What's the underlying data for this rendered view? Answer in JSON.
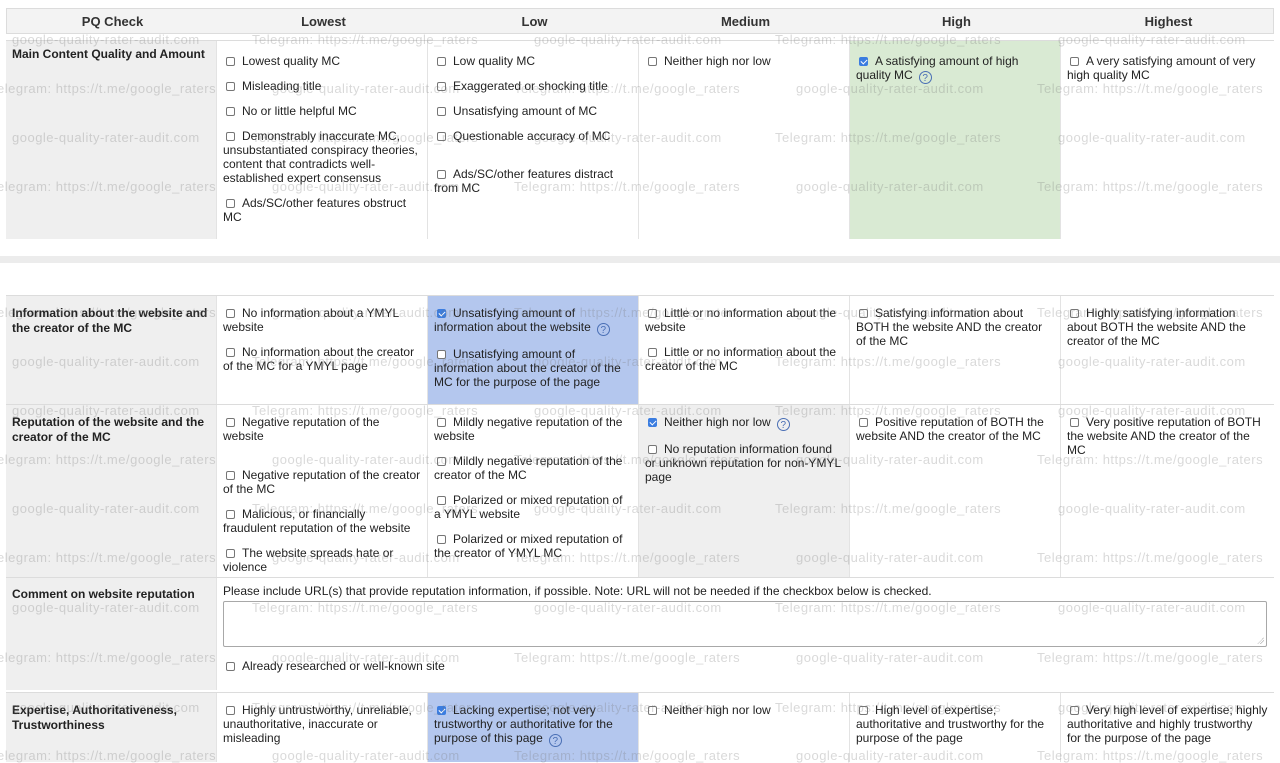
{
  "headers": [
    "PQ Check",
    "Lowest",
    "Low",
    "Medium",
    "High",
    "Highest"
  ],
  "sections": {
    "main_content": {
      "label": "Main Content Quality and Amount",
      "lowest": [
        "Lowest quality MC",
        "Misleading title",
        "No or little helpful MC",
        "Demonstrably inaccurate MC, unsubstantiated conspiracy theories, content that contradicts well-established expert consensus",
        "Ads/SC/other features obstruct MC"
      ],
      "low": [
        "Low quality MC",
        "Exaggerated or shocking title",
        "Unsatisfying amount of MC",
        "Questionable accuracy of MC",
        "Ads/SC/other features distract from MC"
      ],
      "medium": [
        "Neither high nor low"
      ],
      "high": [
        "A satisfying amount of high quality MC"
      ],
      "highest": [
        "A very satisfying amount of very high quality MC"
      ]
    },
    "info": {
      "label": "Information about the website and the creator of the MC",
      "lowest": [
        "No information about a YMYL website",
        "No information about the creator of the MC for a YMYL page"
      ],
      "low": [
        "Unsatisfying amount of information about the website",
        "Unsatisfying amount of information about the creator of the MC for the purpose of the page"
      ],
      "medium": [
        "Little or no information about the website",
        "Little or no information about the creator of the MC"
      ],
      "high": [
        "Satisfying information about BOTH the website AND the creator of the MC"
      ],
      "highest": [
        "Highly satisfying information about BOTH the website AND the creator of the MC"
      ]
    },
    "reputation": {
      "label": "Reputation of the website and the creator of the MC",
      "lowest": [
        "Negative reputation of the website",
        "Negative reputation of the creator of the MC",
        "Malicious, or financially fraudulent reputation of the website",
        "The website spreads hate or violence"
      ],
      "low": [
        "Mildly negative reputation of the website",
        "Mildly negative reputation of the creator of the MC",
        "Polarized or mixed reputation of a YMYL website",
        "Polarized or mixed reputation of the creator of YMYL MC"
      ],
      "medium": [
        "Neither high nor low",
        "No reputation information found or unknown reputation for non-YMYL page"
      ],
      "high": [
        "Positive reputation of BOTH the website AND the creator of the MC"
      ],
      "highest": [
        "Very positive reputation of BOTH the website AND the creator of the MC"
      ]
    },
    "comment": {
      "label": "Comment on website reputation",
      "instructions": "Please include URL(s) that provide reputation information, if possible. Note: URL will not be needed if the checkbox below is checked.",
      "textarea_value": "",
      "checkbox": "Already researched or well-known site"
    },
    "eeat": {
      "label": "Expertise, Authoritativeness, Trustworthiness",
      "lowest": [
        "Highly untrustworthy, unreliable, unauthoritative, inaccurate or misleading"
      ],
      "low": [
        "Lacking expertise; not very trustworthy or authoritative for the purpose of this page"
      ],
      "medium": [
        "Neither high nor low"
      ],
      "high": [
        "High level of expertise; authoritative and trustworthy for the purpose of the page"
      ],
      "highest": [
        "Very high level of expertise; highly authoritative and highly trustworthy for the purpose of the page"
      ]
    }
  },
  "help_glyph": "?",
  "watermarks": [
    "google-quality-rater-audit.com",
    "Telegram: https://t.me/google_raters"
  ],
  "colors": {
    "high_selected": "#d9ead3",
    "low_selected": "#b4c7ee",
    "checkbox_on": "#3b7de0",
    "label_bg": "#efefef"
  }
}
